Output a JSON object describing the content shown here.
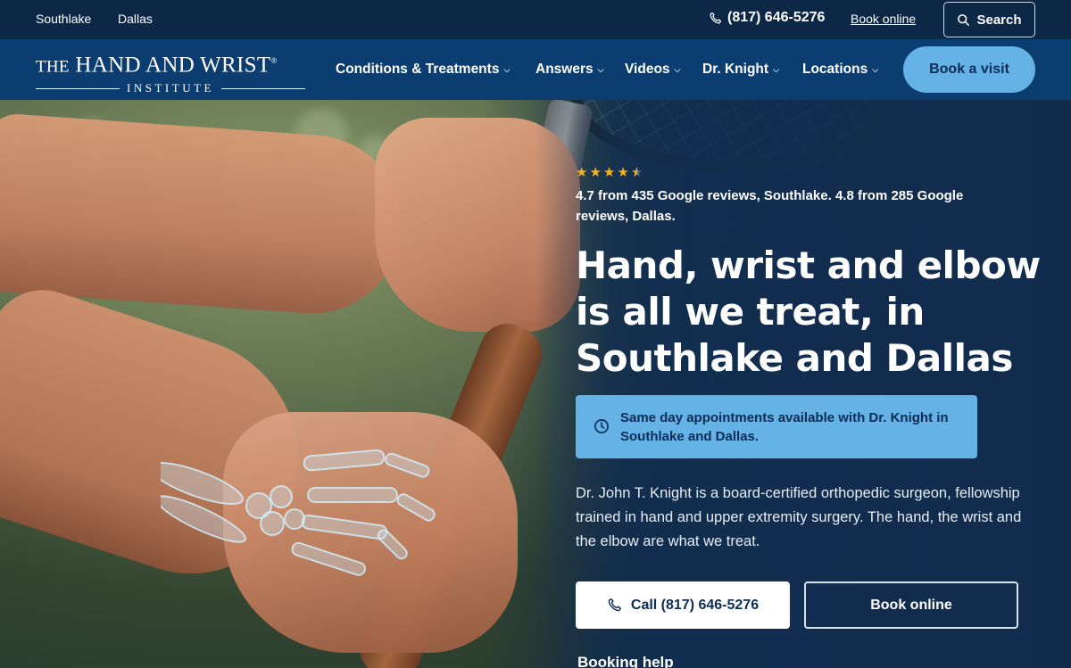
{
  "utility": {
    "locations": [
      "Southlake",
      "Dallas"
    ],
    "phone": "(817) 646-5276",
    "book_online": "Book online",
    "search_label": "Search"
  },
  "logo": {
    "line1_the": "THE",
    "line1_rest": "HAND AND WRIST",
    "trademark": "®",
    "line2": "INSTITUTE"
  },
  "nav": {
    "items": [
      {
        "label": "Conditions & Treatments",
        "icon": "chevron-down-icon"
      },
      {
        "label": "Answers",
        "icon": "chevron-down-icon"
      },
      {
        "label": "Videos",
        "icon": "chevron-down-icon"
      },
      {
        "label": "Dr. Knight",
        "icon": "chevron-down-icon"
      },
      {
        "label": "Locations",
        "icon": "chevron-down-icon"
      }
    ],
    "cta": "Book a visit"
  },
  "hero": {
    "rating_stars": 4.7,
    "reviews": "4.7 from 435 Google reviews, Southlake. 4.8 from 285 Google reviews, Dallas.",
    "headline": "Hand, wrist and elbow is all we treat, in Southlake and Dallas",
    "callout": "Same day appointments available with Dr. Knight in Southlake and Dallas.",
    "description": "Dr. John T. Knight is a board-certified orthopedic surgeon, fellowship trained in hand and upper extremity surgery. The hand, the wrist and the elbow are what we treat.",
    "call_button": "Call (817) 646-5276",
    "book_button": "Book online",
    "booking_help": "Booking help"
  },
  "colors": {
    "nav_bg": "#0b3d70",
    "utility_bg": "#0d2747",
    "accent": "#64b2e6",
    "star": "#f6b21b",
    "text_dark": "#0b2c55"
  }
}
